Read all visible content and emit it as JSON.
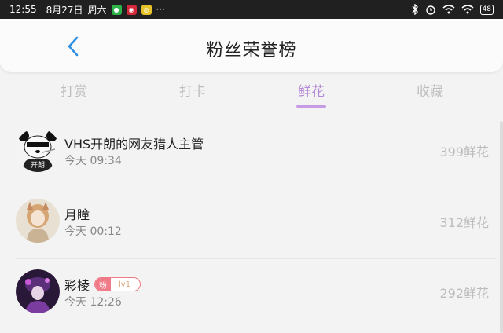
{
  "status_bar": {
    "time": "12:55",
    "date": "8月27日",
    "weekday": "周六",
    "more": "···",
    "battery": "48"
  },
  "header": {
    "title": "粉丝荣誉榜"
  },
  "tabs": [
    {
      "label": "打赏"
    },
    {
      "label": "打卡"
    },
    {
      "label": "鲜花"
    },
    {
      "label": "收藏"
    }
  ],
  "active_tab": "鲜花",
  "colors": {
    "accent": "#b58ad6",
    "back_icon": "#2f8fe5",
    "badge_fan": "#ef7b88"
  },
  "list": [
    {
      "name": "VHS开朗的网友猎人主管",
      "time": "今天 09:34",
      "amount": "399鲜花",
      "avatar_text": "开朗"
    },
    {
      "name": "月瞳",
      "time": "今天 00:12",
      "amount": "312鲜花"
    },
    {
      "name": "彩棱",
      "time": "今天 12:26",
      "amount": "292鲜花",
      "badge": {
        "fan": "粉",
        "level": "lv1"
      }
    }
  ]
}
